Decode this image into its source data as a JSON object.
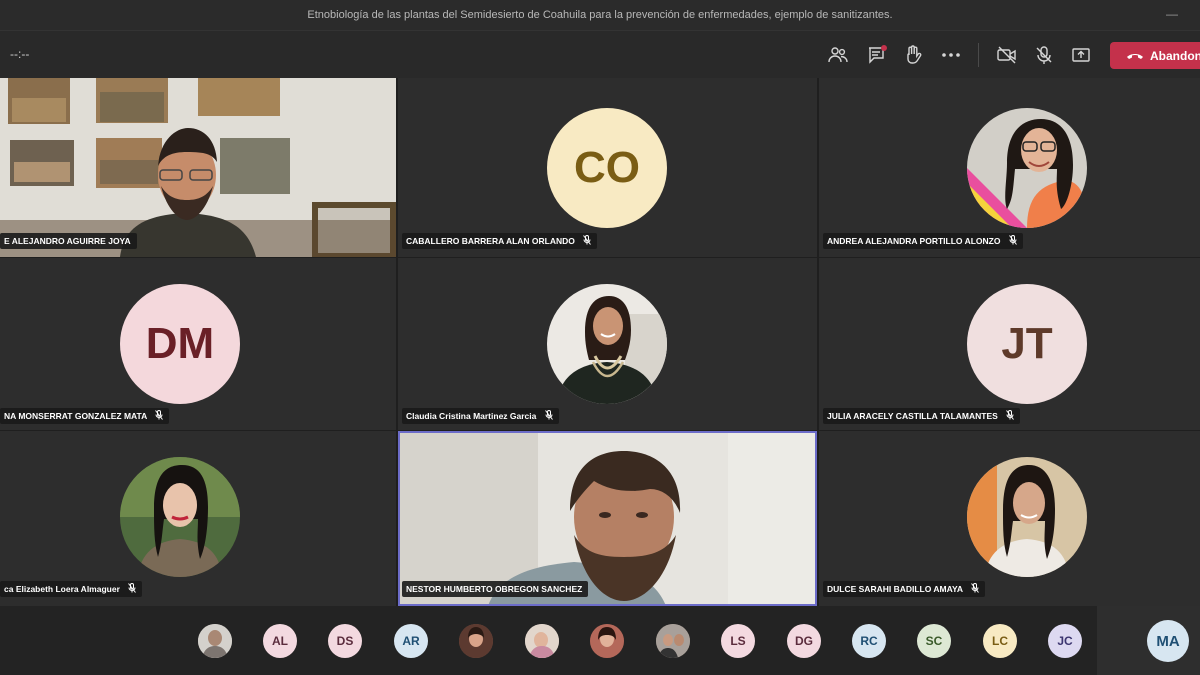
{
  "window": {
    "title": "Etnobiología de las plantas del Semidesierto de Coahuila para la prevención de enfermedades, ejemplo de sanitizantes."
  },
  "toolbar": {
    "timer": "--:--",
    "icons": [
      "participants-icon",
      "chat-icon",
      "raise-hand-icon",
      "more-options-icon",
      "camera-off-icon",
      "mic-off-icon",
      "share-screen-icon"
    ],
    "leave_label": "Abandonar",
    "leave_color": "#c4314b"
  },
  "participants": [
    {
      "name": "E ALEJANDRO AGUIRRE JOYA",
      "type": "video"
    },
    {
      "name": "CABALLERO BARRERA ALAN ORLANDO",
      "type": "initials",
      "initials": "CO",
      "bg": "#f8eac3",
      "fg": "#7a5d14"
    },
    {
      "name": "ANDREA ALEJANDRA PORTILLO ALONZO",
      "type": "photo"
    },
    {
      "name": "NA MONSERRAT GONZALEZ MATA",
      "type": "initials",
      "initials": "DM",
      "bg": "#f4d8dc",
      "fg": "#6a2027"
    },
    {
      "name": "Claudia Cristina Martinez Garcia",
      "type": "photo"
    },
    {
      "name": "JULIA ARACELY CASTILLA TALAMANTES",
      "type": "initials",
      "initials": "JT",
      "bg": "#f0dfdf",
      "fg": "#5e3a2a"
    },
    {
      "name": "ca Elizabeth Loera Almaguer",
      "type": "photo"
    },
    {
      "name": "NESTOR HUMBERTO OBREGON SANCHEZ",
      "type": "video"
    },
    {
      "name": "DULCE SARAHI BADILLO AMAYA",
      "type": "photo"
    }
  ],
  "overflow_avatars": [
    {
      "initials": "",
      "photo": true
    },
    {
      "initials": "AL",
      "bg": "#f3d9e0",
      "fg": "#5b2c3d"
    },
    {
      "initials": "DS",
      "bg": "#f3d9e0",
      "fg": "#5b2c3d"
    },
    {
      "initials": "AR",
      "bg": "#d7e6f1",
      "fg": "#1f4f73"
    },
    {
      "initials": "",
      "photo": true
    },
    {
      "initials": "",
      "photo": true
    },
    {
      "initials": "",
      "photo": true
    },
    {
      "initials": "",
      "photo": true
    },
    {
      "initials": "LS",
      "bg": "#f3d9e0",
      "fg": "#5b2c3d"
    },
    {
      "initials": "DG",
      "bg": "#f3d9e0",
      "fg": "#5b2c3d"
    },
    {
      "initials": "RC",
      "bg": "#d7e6f1",
      "fg": "#1f4f73"
    },
    {
      "initials": "SC",
      "bg": "#dde8d4",
      "fg": "#3a5a2a"
    },
    {
      "initials": "LC",
      "bg": "#f8eac3",
      "fg": "#7a5d14"
    },
    {
      "initials": "JC",
      "bg": "#ddd9f1",
      "fg": "#3c3570"
    }
  ],
  "self_avatar": {
    "initials": "MA",
    "bg": "#d7e6f1",
    "fg": "#1f4f73"
  }
}
